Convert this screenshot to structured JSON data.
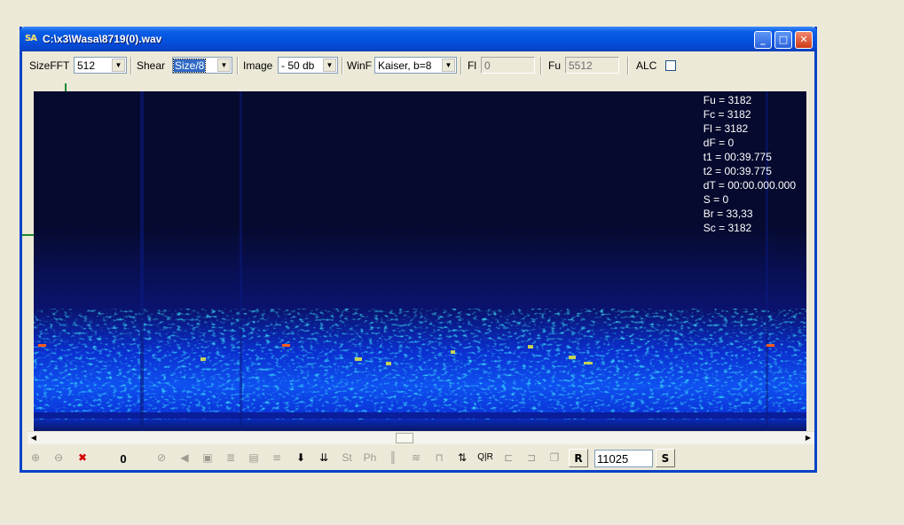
{
  "window": {
    "title": "C:\\x3\\Wasa\\8719(0).wav",
    "app_icon": "SA",
    "buttons": {
      "minimize": "_",
      "maximize": "□",
      "close": "✕"
    }
  },
  "toolbar": {
    "sizefft_label": "SizeFFT",
    "sizefft_value": "512",
    "shear_label": "Shear",
    "shear_value": "Size/8",
    "image_label": "Image",
    "image_value": "- 50 db",
    "winf_label": "WinF",
    "winf_value": "Kaiser, b=8",
    "fl_label": "Fl",
    "fl_value": "0",
    "fu_label": "Fu",
    "fu_value": "5512",
    "alc_label": "ALC",
    "alc_checked": false
  },
  "readout": {
    "fu": "Fu = 3182",
    "fc": "Fc = 3182",
    "fl": "Fl = 3182",
    "df": "dF = 0",
    "t1": "t1 = 00:39.775",
    "t2": "t2 = 00:39.775",
    "dt": "dT = 00:00.000.000",
    "s": "S = 0",
    "br": "Br = 33,33",
    "sc": "Sc = 3182"
  },
  "bottombar": {
    "counter": "0",
    "ph_label": "Ph",
    "st_label": "St",
    "qr_label": "Q|R",
    "r_label": "R",
    "sample_rate": "11025",
    "s_label": "S"
  },
  "colors": {
    "spectrogram_bg": "#060a2e",
    "title_blue": "#0a5ee6",
    "marker_green": "#1c8a2a"
  }
}
